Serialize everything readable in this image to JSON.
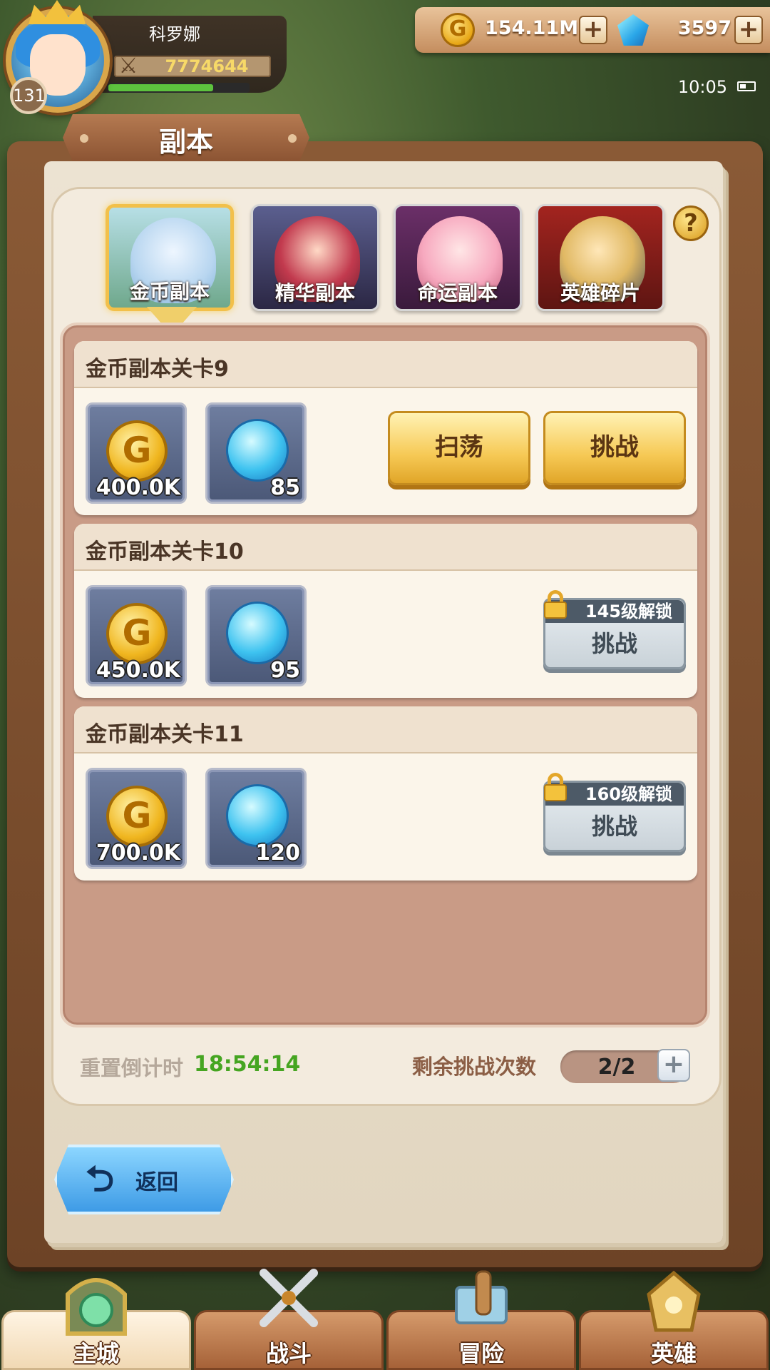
{
  "player": {
    "name": "科罗娜",
    "level": "131",
    "power": "7774644",
    "exp_fraction": 0.75
  },
  "currency": {
    "gold": "154.11M",
    "gems": "3597"
  },
  "status": {
    "time": "10:05"
  },
  "page": {
    "title": "副本"
  },
  "tabs": [
    {
      "label": "金币副本",
      "active": true
    },
    {
      "label": "精华副本",
      "active": false
    },
    {
      "label": "命运副本",
      "active": false
    },
    {
      "label": "英雄碎片",
      "active": false
    }
  ],
  "help": {
    "label": "?"
  },
  "stages": [
    {
      "title": "金币副本关卡9",
      "gold_reward": "400.0K",
      "orb_reward": "85",
      "sweep_label": "扫荡",
      "challenge_label": "挑战",
      "locked": false
    },
    {
      "title": "金币副本关卡10",
      "gold_reward": "450.0K",
      "orb_reward": "95",
      "unlock_text": "145级解锁",
      "challenge_label": "挑战",
      "locked": true
    },
    {
      "title": "金币副本关卡11",
      "gold_reward": "700.0K",
      "orb_reward": "120",
      "unlock_text": "160级解锁",
      "challenge_label": "挑战",
      "locked": true
    }
  ],
  "footer": {
    "reset_label": "重置倒计时",
    "reset_time": "18:54:14",
    "remaining_label": "剩余挑战次数",
    "remaining_value": "2/2"
  },
  "back_button": {
    "label": "返回"
  },
  "bottom_nav": [
    {
      "label": "主城",
      "active": true
    },
    {
      "label": "战斗",
      "active": false
    },
    {
      "label": "冒险",
      "active": false
    },
    {
      "label": "英雄",
      "active": false
    }
  ],
  "colors": {
    "countdown": "#45a521",
    "gold_button": "#f6c955",
    "locked_button": "#c9d2d8"
  }
}
